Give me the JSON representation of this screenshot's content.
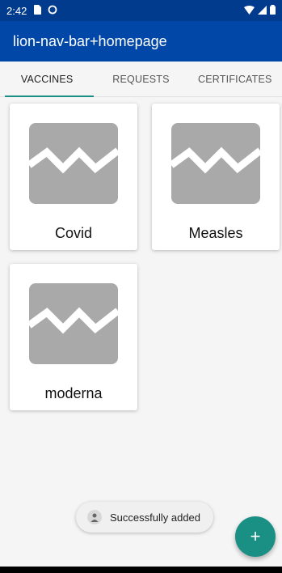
{
  "status_bar": {
    "time": "2:42",
    "icons": [
      "sim-icon",
      "sync-icon",
      "wifi-icon",
      "signal-icon",
      "battery-icon"
    ]
  },
  "app_bar": {
    "title": "lion-nav-bar+homepage"
  },
  "tabs": [
    {
      "label": "VACCINES",
      "active": true
    },
    {
      "label": "REQUESTS",
      "active": false
    },
    {
      "label": "CERTIFICATES",
      "active": false
    }
  ],
  "cards": [
    {
      "label": "Covid",
      "icon": "image-placeholder-icon"
    },
    {
      "label": "Measles",
      "icon": "image-placeholder-icon"
    },
    {
      "label": "moderna",
      "icon": "image-placeholder-icon"
    }
  ],
  "toast": {
    "message": "Successfully added",
    "icon": "app-icon"
  },
  "fab": {
    "label": "+",
    "icon": "add-icon"
  },
  "colors": {
    "status_bar": "#003b8e",
    "app_bar": "#0047a8",
    "accent": "#1a8f84",
    "placeholder": "#a9a9a9"
  }
}
